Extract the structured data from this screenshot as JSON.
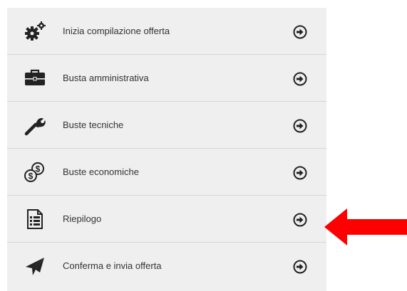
{
  "menu": {
    "items": [
      {
        "label": "Inizia compilazione offerta",
        "icon": "gears-icon"
      },
      {
        "label": "Busta amministrativa",
        "icon": "briefcase-icon"
      },
      {
        "label": "Buste tecniche",
        "icon": "wrench-icon"
      },
      {
        "label": "Buste economiche",
        "icon": "coins-icon"
      },
      {
        "label": "Riepilogo",
        "icon": "list-document-icon"
      },
      {
        "label": "Conferma e invia offerta",
        "icon": "paper-plane-icon"
      }
    ]
  },
  "colors": {
    "panel_background": "#efefef",
    "divider": "#d6d6d6",
    "text": "#333333",
    "icon": "#222222",
    "callout_arrow": "#ff0000"
  }
}
